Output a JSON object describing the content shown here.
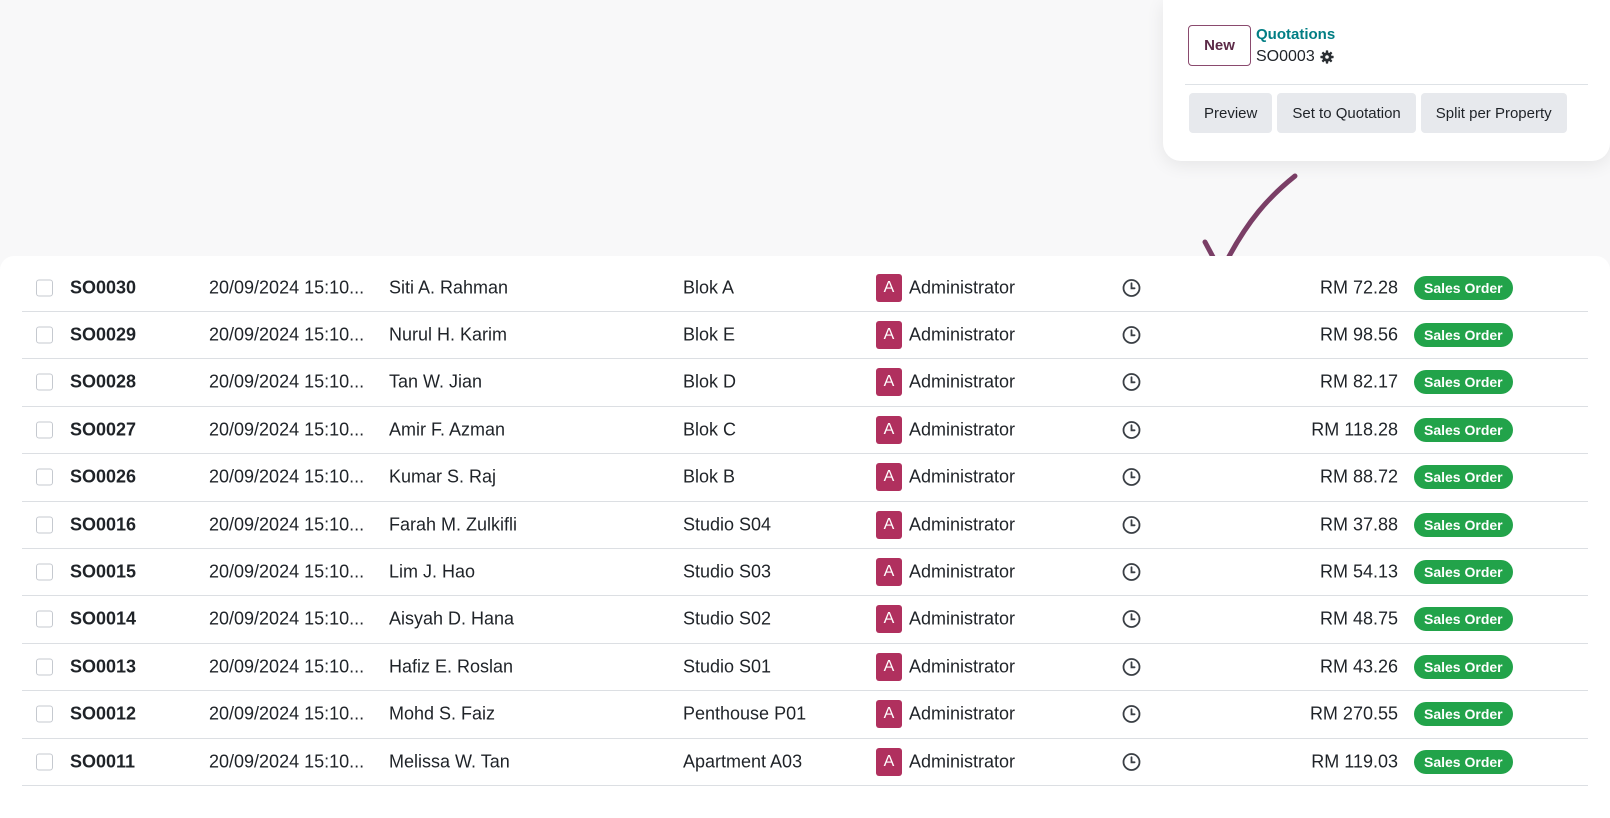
{
  "popup": {
    "new_label": "New",
    "breadcrumb_parent": "Quotations",
    "breadcrumb_current": "SO0003",
    "actions": [
      "Preview",
      "Set to Quotation",
      "Split per Property"
    ]
  },
  "colors": {
    "brand": "#714b67",
    "link": "#017e84",
    "avatar": "#b0305e",
    "badge_success": "#22a34a",
    "arrow": "#7a3e66"
  },
  "rows": [
    {
      "ref": "SO0030",
      "date": "20/09/2024 15:10...",
      "customer": "Siti A. Rahman",
      "property": "Blok A",
      "avatar": "A",
      "salesperson": "Administrator",
      "amount": "RM 72.28",
      "status": "Sales Order"
    },
    {
      "ref": "SO0029",
      "date": "20/09/2024 15:10...",
      "customer": "Nurul H. Karim",
      "property": "Blok E",
      "avatar": "A",
      "salesperson": "Administrator",
      "amount": "RM 98.56",
      "status": "Sales Order"
    },
    {
      "ref": "SO0028",
      "date": "20/09/2024 15:10...",
      "customer": "Tan W. Jian",
      "property": "Blok D",
      "avatar": "A",
      "salesperson": "Administrator",
      "amount": "RM 82.17",
      "status": "Sales Order"
    },
    {
      "ref": "SO0027",
      "date": "20/09/2024 15:10...",
      "customer": "Amir F. Azman",
      "property": "Blok C",
      "avatar": "A",
      "salesperson": "Administrator",
      "amount": "RM 118.28",
      "status": "Sales Order"
    },
    {
      "ref": "SO0026",
      "date": "20/09/2024 15:10...",
      "customer": "Kumar S. Raj",
      "property": "Blok B",
      "avatar": "A",
      "salesperson": "Administrator",
      "amount": "RM 88.72",
      "status": "Sales Order"
    },
    {
      "ref": "SO0016",
      "date": "20/09/2024 15:10...",
      "customer": "Farah M. Zulkifli",
      "property": "Studio S04",
      "avatar": "A",
      "salesperson": "Administrator",
      "amount": "RM 37.88",
      "status": "Sales Order"
    },
    {
      "ref": "SO0015",
      "date": "20/09/2024 15:10...",
      "customer": "Lim J. Hao",
      "property": "Studio S03",
      "avatar": "A",
      "salesperson": "Administrator",
      "amount": "RM 54.13",
      "status": "Sales Order"
    },
    {
      "ref": "SO0014",
      "date": "20/09/2024 15:10...",
      "customer": "Aisyah D. Hana",
      "property": "Studio S02",
      "avatar": "A",
      "salesperson": "Administrator",
      "amount": "RM 48.75",
      "status": "Sales Order"
    },
    {
      "ref": "SO0013",
      "date": "20/09/2024 15:10...",
      "customer": "Hafiz E. Roslan",
      "property": "Studio S01",
      "avatar": "A",
      "salesperson": "Administrator",
      "amount": "RM 43.26",
      "status": "Sales Order"
    },
    {
      "ref": "SO0012",
      "date": "20/09/2024 15:10...",
      "customer": "Mohd S. Faiz",
      "property": "Penthouse P01",
      "avatar": "A",
      "salesperson": "Administrator",
      "amount": "RM 270.55",
      "status": "Sales Order"
    },
    {
      "ref": "SO0011",
      "date": "20/09/2024 15:10...",
      "customer": "Melissa W. Tan",
      "property": "Apartment A03",
      "avatar": "A",
      "salesperson": "Administrator",
      "amount": "RM 119.03",
      "status": "Sales Order"
    }
  ]
}
